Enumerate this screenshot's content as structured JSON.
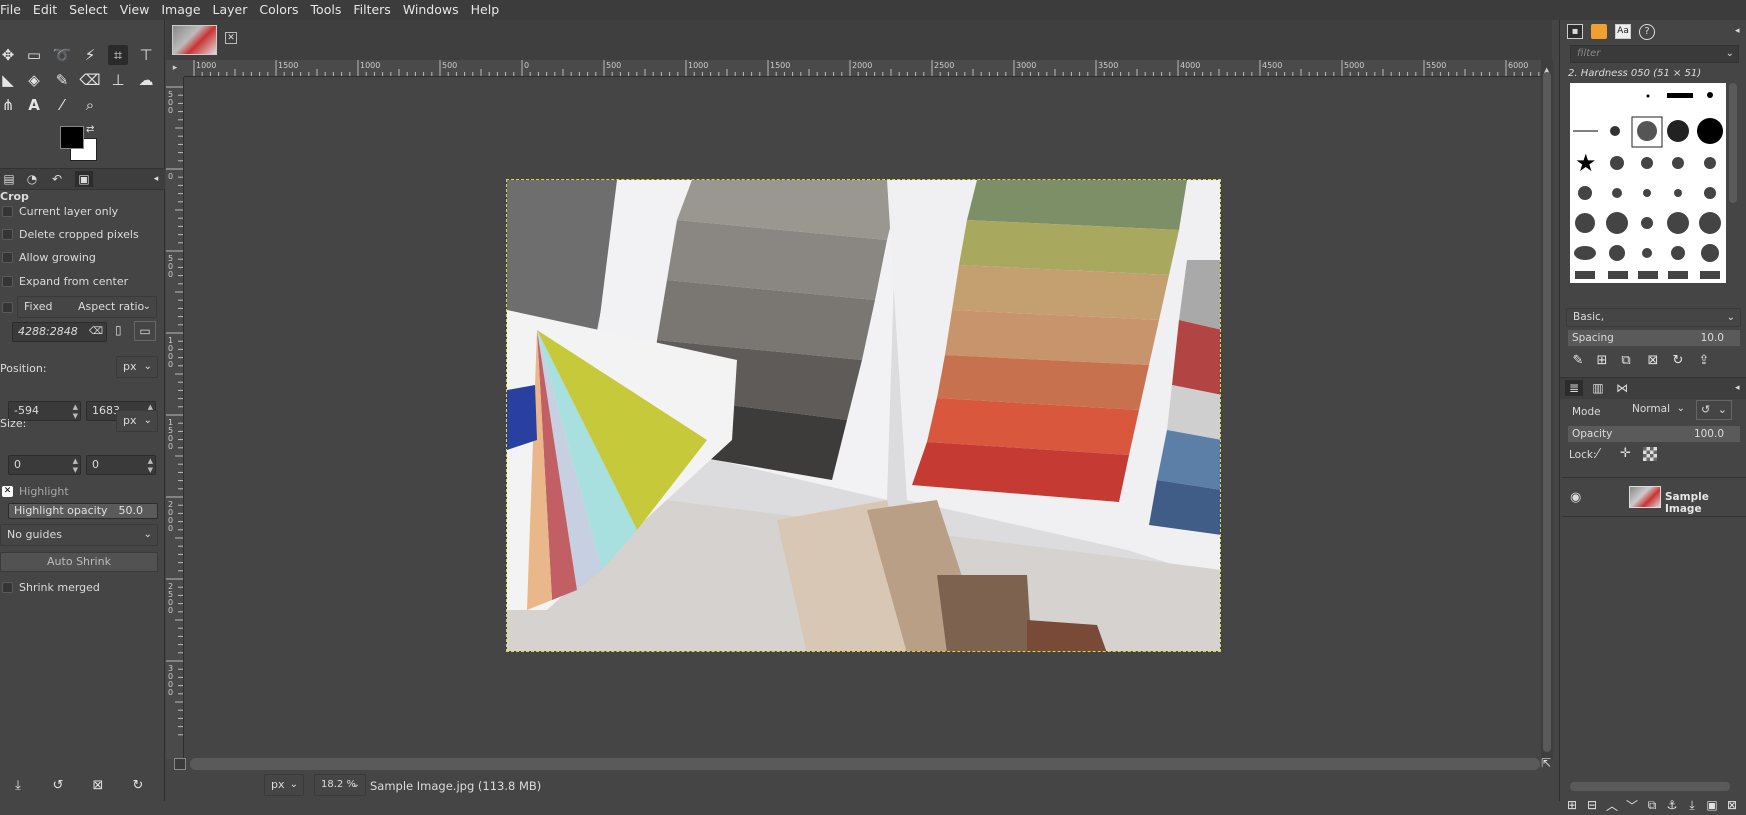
{
  "menubar": [
    "File",
    "Edit",
    "Select",
    "View",
    "Image",
    "Layer",
    "Colors",
    "Tools",
    "Filters",
    "Windows",
    "Help"
  ],
  "tool_options": {
    "title": "Crop",
    "current_layer_only": "Current layer only",
    "delete_cropped_pixels": "Delete cropped pixels",
    "allow_growing": "Allow growing",
    "expand_from_center": "Expand from center",
    "fixed_label": "Fixed",
    "fixed_mode": "Aspect ratio",
    "ratio_value": "4288:2848",
    "position_label": "Position:",
    "position_unit": "px",
    "position_x": "-594",
    "position_y": "1683",
    "size_label": "Size:",
    "size_unit": "px",
    "size_w": "0",
    "size_h": "0",
    "highlight": "Highlight",
    "highlight_opacity_label": "Highlight opacity",
    "highlight_opacity_value": "50.0",
    "guides": "No guides",
    "auto_shrink": "Auto Shrink",
    "shrink_merged": "Shrink merged"
  },
  "ruler_top_labels": [
    "1000",
    "1500",
    "1000",
    "500",
    "0",
    "500",
    "1000",
    "1500",
    "2000",
    "2500",
    "3000",
    "3500",
    "4000",
    "4500",
    "5000",
    "5500",
    "6000"
  ],
  "ruler_left_labels": [
    "500",
    "0",
    "500",
    "1000",
    "1500",
    "2000",
    "2500",
    "3000"
  ],
  "statusbar": {
    "unit": "px",
    "zoom": "18.2 %",
    "file_info": "Sample Image.jpg (113.8 MB)"
  },
  "brushes": {
    "filter_placeholder": "filter",
    "current_brush": "2. Hardness 050 (51 × 51)",
    "preset": "Basic,",
    "spacing_label": "Spacing",
    "spacing_value": "10.0"
  },
  "layers": {
    "mode_label": "Mode",
    "mode_value": "Normal",
    "opacity_label": "Opacity",
    "opacity_value": "100.0",
    "lock_label": "Lock:",
    "layer_name": "Sample Image"
  },
  "colors": {
    "ui_bg": "#454545",
    "menubar_bg": "#3c3c3c",
    "foreground": "#000000",
    "background": "#ffffff",
    "selection_dash": "#d8d840"
  }
}
